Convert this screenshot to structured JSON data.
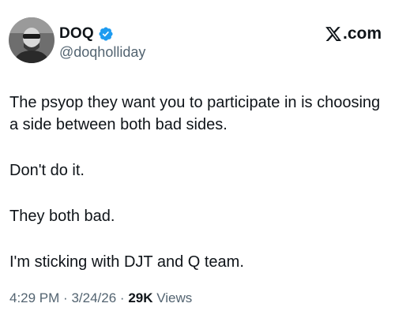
{
  "author": {
    "display_name": "DOQ",
    "handle": "@doqholliday",
    "avatar_icon": "avatar-photo",
    "verified_icon": "verified-badge-icon",
    "verified_color": "#1d9bf0"
  },
  "brand": {
    "icon": "x-logo-icon",
    "text": ".com"
  },
  "tweet": {
    "paragraphs": [
      "The psyop they want you to participate in is choosing a side between both bad sides.",
      "Don't do it.",
      "They both bad.",
      "I'm sticking with DJT and Q team."
    ]
  },
  "meta": {
    "time": "4:29 PM",
    "separator": "·",
    "date": "3/24/26",
    "views_count": "29K",
    "views_label": "Views"
  },
  "colors": {
    "text_primary": "#0f1419",
    "text_secondary": "#536471",
    "background": "#ffffff"
  }
}
